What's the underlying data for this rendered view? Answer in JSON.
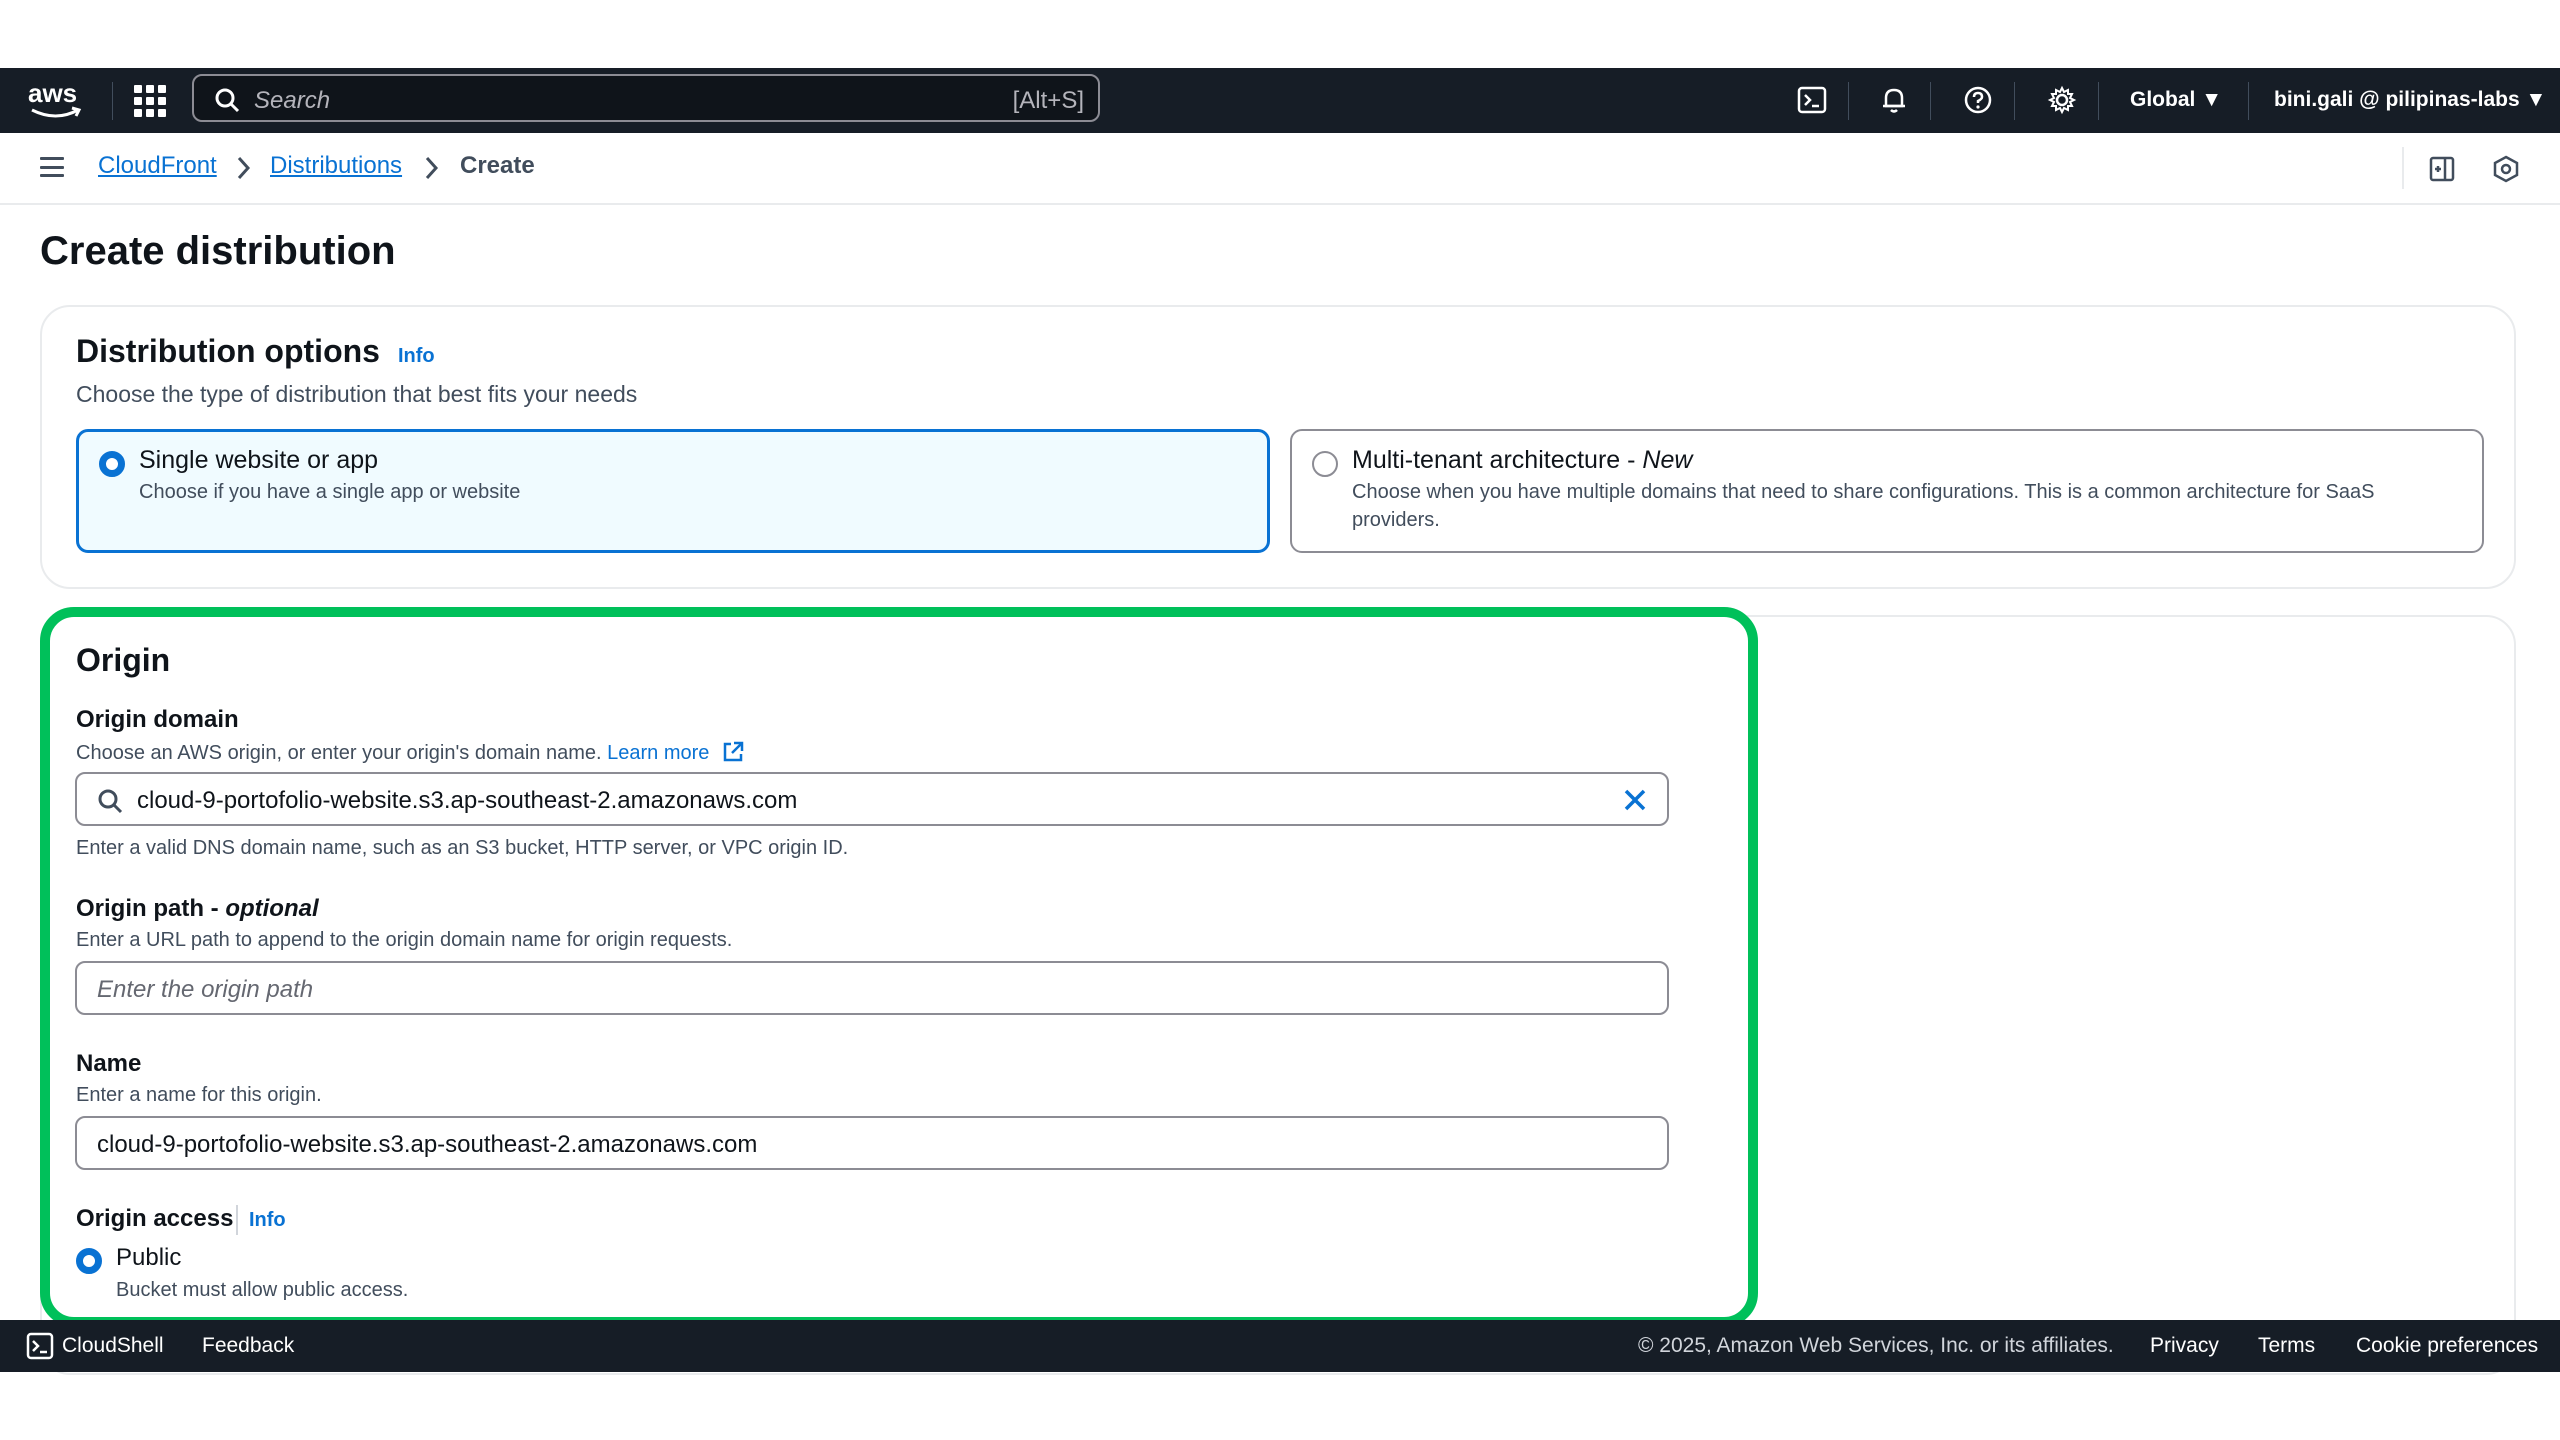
{
  "topnav": {
    "logo_text": "aws",
    "search_placeholder": "Search",
    "search_shortcut": "[Alt+S]",
    "region": "Global",
    "account": "bini.gali @ pilipinas-labs",
    "icons": [
      "cloudshell-icon",
      "bell-icon",
      "help-icon",
      "gear-icon"
    ]
  },
  "breadcrumb": {
    "items": [
      "CloudFront",
      "Distributions",
      "Create"
    ]
  },
  "page": {
    "title": "Create distribution"
  },
  "distribution_options": {
    "title": "Distribution options",
    "info": "Info",
    "description": "Choose the type of distribution that best fits your needs",
    "options": [
      {
        "label": "Single website or app",
        "description": "Choose if you have a single app or website",
        "selected": true
      },
      {
        "label": "Multi-tenant architecture - ",
        "label_suffix": "New",
        "description": "Choose when you have multiple domains that need to share configurations. This is a common architecture for SaaS providers.",
        "selected": false
      }
    ]
  },
  "origin": {
    "title": "Origin",
    "domain": {
      "label": "Origin domain",
      "description": "Choose an AWS origin, or enter your origin's domain name.",
      "learn_more": "Learn more",
      "value": "cloud-9-portofolio-website.s3.ap-southeast-2.amazonaws.com",
      "hint": "Enter a valid DNS domain name, such as an S3 bucket, HTTP server, or VPC origin ID."
    },
    "path": {
      "label": "Origin path - ",
      "label_suffix": "optional",
      "description": "Enter a URL path to append to the origin domain name for origin requests.",
      "placeholder": "Enter the origin path"
    },
    "name": {
      "label": "Name",
      "description": "Enter a name for this origin.",
      "value": "cloud-9-portofolio-website.s3.ap-southeast-2.amazonaws.com"
    },
    "access": {
      "label": "Origin access",
      "info": "Info",
      "option_label": "Public",
      "option_description": "Bucket must allow public access.",
      "selected": true
    }
  },
  "footer": {
    "cloudshell": "CloudShell",
    "feedback": "Feedback",
    "copyright": "© 2025, Amazon Web Services, Inc. or its affiliates.",
    "privacy": "Privacy",
    "terms": "Terms",
    "cookies": "Cookie preferences"
  },
  "colors": {
    "nav_bg": "#161d26",
    "link": "#0972d3",
    "highlight": "#00c05a",
    "selected_tile_bg": "#f0fbff"
  }
}
